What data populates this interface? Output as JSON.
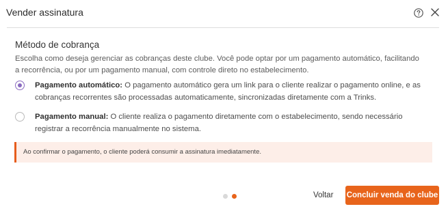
{
  "header": {
    "title": "Vender assinatura",
    "help_icon": "question-circle-icon",
    "close_icon": "close-icon"
  },
  "billing": {
    "section_title": "Método de cobrança",
    "description": "Escolha como deseja gerenciar as cobranças deste clube. Você pode optar por um pagamento automático, facilitando a recorrência, ou por um pagamento manual, com controle direto no estabelecimento.",
    "options": [
      {
        "label": "Pagamento automático:",
        "text": " O pagamento automático gera um link para o cliente realizar o pagamento online, e as cobranças recorrentes são processadas automaticamente, sincronizadas diretamente com a Trinks.",
        "selected": true
      },
      {
        "label": "Pagamento manual:",
        "text": " O cliente realiza o pagamento diretamente com o estabelecimento, sendo necessário registrar a recorrência manualmente no sistema.",
        "selected": false
      }
    ]
  },
  "alert": {
    "text": "Ao confirmar o pagamento, o cliente poderá consumir a assinatura imediatamente."
  },
  "footer": {
    "step_current": 2,
    "step_total": 2,
    "back_label": "Voltar",
    "confirm_label": "Concluir venda do clube"
  },
  "colors": {
    "accent": "#e8641b",
    "radio_selected": "#8a6ac0",
    "alert_bg": "#fdeee8"
  }
}
